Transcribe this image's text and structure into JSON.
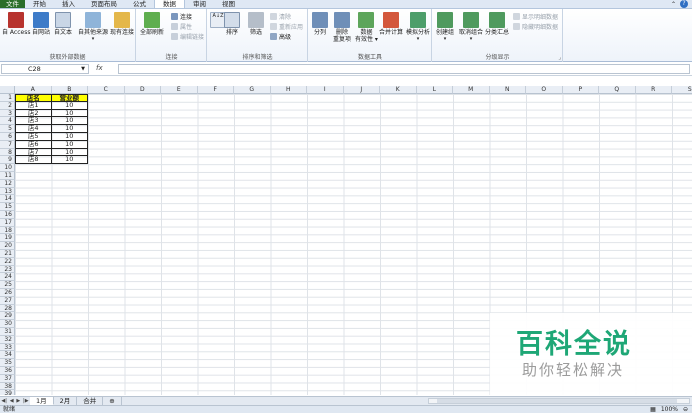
{
  "tabs": [
    "文件",
    "开始",
    "插入",
    "页面布局",
    "公式",
    "数据",
    "审阅",
    "视图"
  ],
  "ribbon": {
    "external": {
      "access": "自 Access",
      "web": "自网站",
      "text": "自文本",
      "other": "自其他来源",
      "existing": "现有连接",
      "group": "获取外部数据"
    },
    "connections": {
      "refresh": "全部刷新",
      "conn": "连接",
      "props": "属性",
      "edit": "编辑链接",
      "group": "连接"
    },
    "sort": {
      "az": "A↓Z",
      "sort": "排序",
      "filter": "筛选",
      "clear": "清除",
      "reapply": "重新应用",
      "advanced": "高级",
      "group": "排序和筛选"
    },
    "tools": {
      "split": "分列",
      "dedupe1": "删除",
      "dedupe2": "重复项",
      "valid1": "数据",
      "valid2": "有效性 ▾",
      "consolidate": "合并计算",
      "whatif": "模拟分析",
      "group": "数据工具"
    },
    "outline": {
      "group_btn": "创建组",
      "ungroup": "取消组合",
      "subtotal": "分类汇总",
      "show": "显示明细数据",
      "hide": "隐藏明细数据",
      "group": "分级显示"
    }
  },
  "formula_bar": {
    "name_box": "C28",
    "fx": "fx",
    "content": ""
  },
  "columns": [
    "A",
    "B",
    "C",
    "D",
    "E",
    "F",
    "G",
    "H",
    "I",
    "J",
    "K",
    "L",
    "M",
    "N",
    "O",
    "P",
    "Q",
    "R",
    "S"
  ],
  "rows": [
    "1",
    "2",
    "3",
    "4",
    "5",
    "6",
    "7",
    "8",
    "9",
    "10",
    "11",
    "12",
    "13",
    "14",
    "15",
    "16",
    "17",
    "18",
    "19",
    "20",
    "21",
    "22",
    "23",
    "24",
    "25",
    "26",
    "27",
    "28",
    "29",
    "30",
    "31",
    "32",
    "33",
    "34",
    "35",
    "36",
    "37",
    "38",
    "39"
  ],
  "table": {
    "headers": [
      "店名",
      "营业额"
    ],
    "rows": [
      [
        "店1",
        "10"
      ],
      [
        "店2",
        "10"
      ],
      [
        "店3",
        "10"
      ],
      [
        "店4",
        "10"
      ],
      [
        "店5",
        "10"
      ],
      [
        "店6",
        "10"
      ],
      [
        "店7",
        "10"
      ],
      [
        "店8",
        "10"
      ]
    ]
  },
  "sheets": [
    "1月",
    "2月",
    "合并"
  ],
  "status": {
    "left": "就绪",
    "zoom": "100%"
  },
  "watermark": {
    "title": "百科全说",
    "subtitle": "助你轻松解决"
  },
  "colors": {
    "file_tab": "#2a6e2a",
    "header_fill": "#ffff00",
    "watermark": "#1ea776"
  }
}
